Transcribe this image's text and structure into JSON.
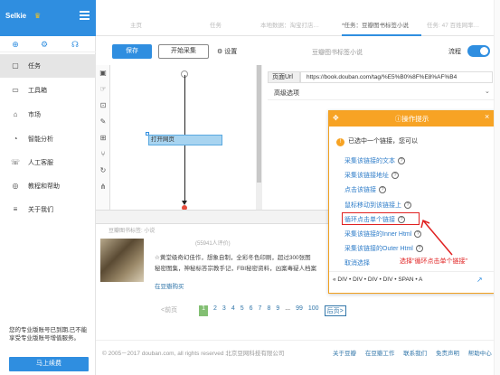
{
  "app": {
    "name": "Selkie",
    "badge_icon": "crown-icon"
  },
  "sidebar": {
    "tools": [
      {
        "icon": "plus-icon"
      },
      {
        "icon": "gear-icon"
      },
      {
        "icon": "headset-icon"
      }
    ],
    "items": [
      {
        "label": "任务",
        "icon": "document-icon",
        "active": true
      },
      {
        "label": "工具箱",
        "icon": "toolbox-icon"
      },
      {
        "label": "市场",
        "icon": "shop-icon"
      },
      {
        "label": "智能分析",
        "icon": "analytics-icon"
      },
      {
        "label": "人工客服",
        "icon": "chat-icon"
      },
      {
        "label": "教程和帮助",
        "icon": "help-icon"
      },
      {
        "label": "关于我们",
        "icon": "info-icon"
      }
    ],
    "note": "您的专业版账号已到期,已不能享受专业版账号增值服务。",
    "login_button": "马上续费"
  },
  "tabs": [
    {
      "label": "主页"
    },
    {
      "label": "任务"
    },
    {
      "label": "本地数据：淘宝打店…"
    },
    {
      "label": "*任务：豆瓣图书标签小说",
      "active": true
    },
    {
      "label": "任务: 47 百姓网率…"
    }
  ],
  "toolbar": {
    "save_label": "保存",
    "collect_label": "开始采集",
    "settings_label": "设置",
    "task_name": "豆瓣图书标签小说",
    "flow_label": "流程",
    "flow_on": true
  },
  "workflow": {
    "tools": [
      "cursor-icon",
      "hand-icon",
      "crop-icon",
      "edit-icon",
      "loop-icon",
      "branch-icon",
      "refresh-icon",
      "tree-icon"
    ],
    "node_label": "打开网页"
  },
  "page_url": {
    "label": "页面Url",
    "value": "https://book.douban.com/tag/%E5%B0%8F%E8%AF%B4"
  },
  "advanced": {
    "label": "高级选项"
  },
  "preview": {
    "url_text": "豆瓣图书标签: 小说",
    "rating_text": "(55941人评价)",
    "desc_line1": "☆黄堂级奇幻佳作，想象自制，全彩冬色印刷，超过300张图",
    "desc_line2": "秘密图集，神秘标答宗教手记，FBI秘密资料，凶案毒疑人档案",
    "buy_link": "在豆瓣购买",
    "pagination": {
      "prev": "<前页",
      "current": "1",
      "pages": [
        "2",
        "3",
        "4",
        "5",
        "6",
        "7",
        "8",
        "9"
      ],
      "ellipsis": "...",
      "tail": [
        "99",
        "100"
      ],
      "next": "后页>"
    },
    "copyright": "© 2005－2017 douban.com, all rights reserved 北京豆网科技有限公司",
    "footer_links": [
      "关于豆瓣",
      "在豆瓣工作",
      "联系我们",
      "免责声明",
      "帮助中心"
    ]
  },
  "tips": {
    "title": "操作提示",
    "status": "已选中一个链接，您可以",
    "options": [
      {
        "label": "采集该链接的文本"
      },
      {
        "label": "采集该链接地址"
      },
      {
        "label": "点击该链接"
      },
      {
        "label": "鼠标移动到该链接上"
      },
      {
        "label": "循环点击单个链接",
        "highlighted": true
      },
      {
        "label": "采集该链接的Inner Html"
      },
      {
        "label": "采集该链接的Outer Html"
      },
      {
        "label": "取消选择",
        "no_help": true
      }
    ],
    "breadcrumb": "«  DIV  •  DIV  •  DIV  •  DIV  •  SPAN  •  A",
    "accent": "#f7a324"
  },
  "annotation": {
    "text": "选择\"循环点击单个链接\"",
    "color": "#e02020"
  },
  "colors": {
    "primary": "#2f8ee0",
    "link": "#2f7dc9"
  }
}
